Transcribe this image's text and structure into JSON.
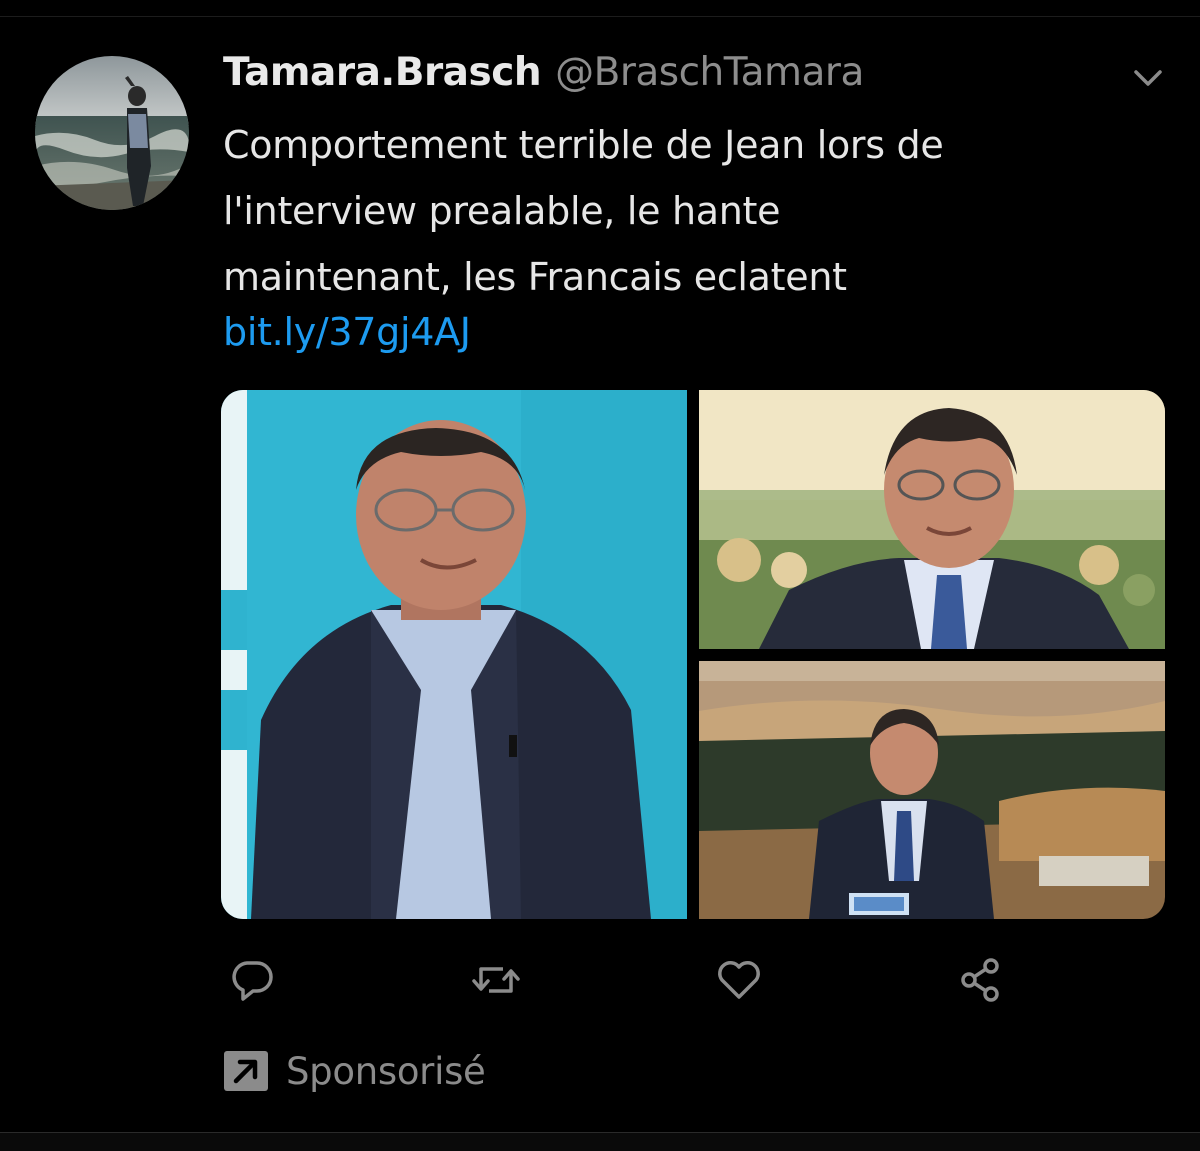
{
  "tweet": {
    "display_name": "Tamara.Brasch",
    "handle": "@BraschTamara",
    "text_lines": [
      "Comportement terrible de Jean lors de",
      "l'interview prealable, le hante",
      "maintenant, les Francais eclatent"
    ],
    "link": "bit.ly/37gj4AJ",
    "sponsored_label": "Sponsorisé"
  },
  "icons": {
    "more": "chevron-down-icon",
    "reply": "reply-icon",
    "retweet": "retweet-icon",
    "like": "heart-icon",
    "share": "share-icon",
    "promoted": "promoted-arrow-icon"
  },
  "colors": {
    "background": "#000000",
    "link": "#1d9bf0",
    "muted": "#8d8d8d",
    "icon": "#8b8b8b"
  }
}
